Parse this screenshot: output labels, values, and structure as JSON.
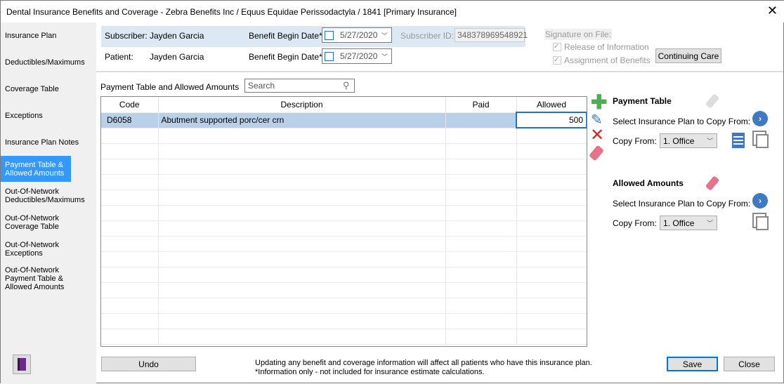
{
  "window": {
    "title": "Dental Insurance Benefits and Coverage - Zebra Benefits Inc / Equus Equidae Perissodactyla / 1841 [Primary Insurance]",
    "close": "✕"
  },
  "sidebar": {
    "items": [
      {
        "label": "Insurance Plan"
      },
      {
        "label": "Deductibles/Maximums"
      },
      {
        "label": "Coverage Table"
      },
      {
        "label": "Exceptions"
      },
      {
        "label": "Insurance Plan Notes"
      },
      {
        "label": "Payment Table & Allowed Amounts"
      },
      {
        "label": "Out-Of-Network Deductibles/Maximums"
      },
      {
        "label": "Out-Of-Network Coverage Table"
      },
      {
        "label": "Out-Of-Network Exceptions"
      },
      {
        "label": "Out-Of-Network Payment Table & Allowed Amounts"
      }
    ],
    "active_index": 5
  },
  "header": {
    "subscriber_label": "Subscriber:",
    "subscriber": "Jayden Garcia",
    "patient_label": "Patient:",
    "patient": "Jayden Garcia",
    "begin_label": "Benefit Begin Date*",
    "subscriber_date": "5/27/2020",
    "patient_date": "5/27/2020",
    "subscriber_id_label": "Subscriber ID:",
    "subscriber_id": "348378969548921",
    "signature_label": "Signature on File:",
    "release": "Release of Information",
    "assignment": "Assignment of Benefits",
    "continuing_care": "Continuing Care"
  },
  "grid": {
    "label": "Payment Table and Allowed Amounts",
    "search_placeholder": "Search",
    "columns": [
      "Code",
      "Description",
      "Paid",
      "Allowed"
    ],
    "rows": [
      {
        "code": "D6058",
        "description": "Abutment supported porc/cer crn",
        "paid": "",
        "allowed": "500"
      }
    ]
  },
  "payment_table": {
    "title": "Payment Table",
    "select_label": "Select Insurance Plan to Copy From:",
    "copy_label": "Copy From:",
    "copy_value": "1. Office"
  },
  "allowed_amounts": {
    "title": "Allowed Amounts",
    "select_label": "Select Insurance Plan to Copy From:",
    "copy_label": "Copy From:",
    "copy_value": "1. Office"
  },
  "footer": {
    "undo": "Undo",
    "note1": "Updating any benefit and coverage information will affect all patients who have this insurance plan.",
    "note2": "*Information only - not included for insurance estimate calculations.",
    "save": "Save",
    "close": "Close"
  }
}
